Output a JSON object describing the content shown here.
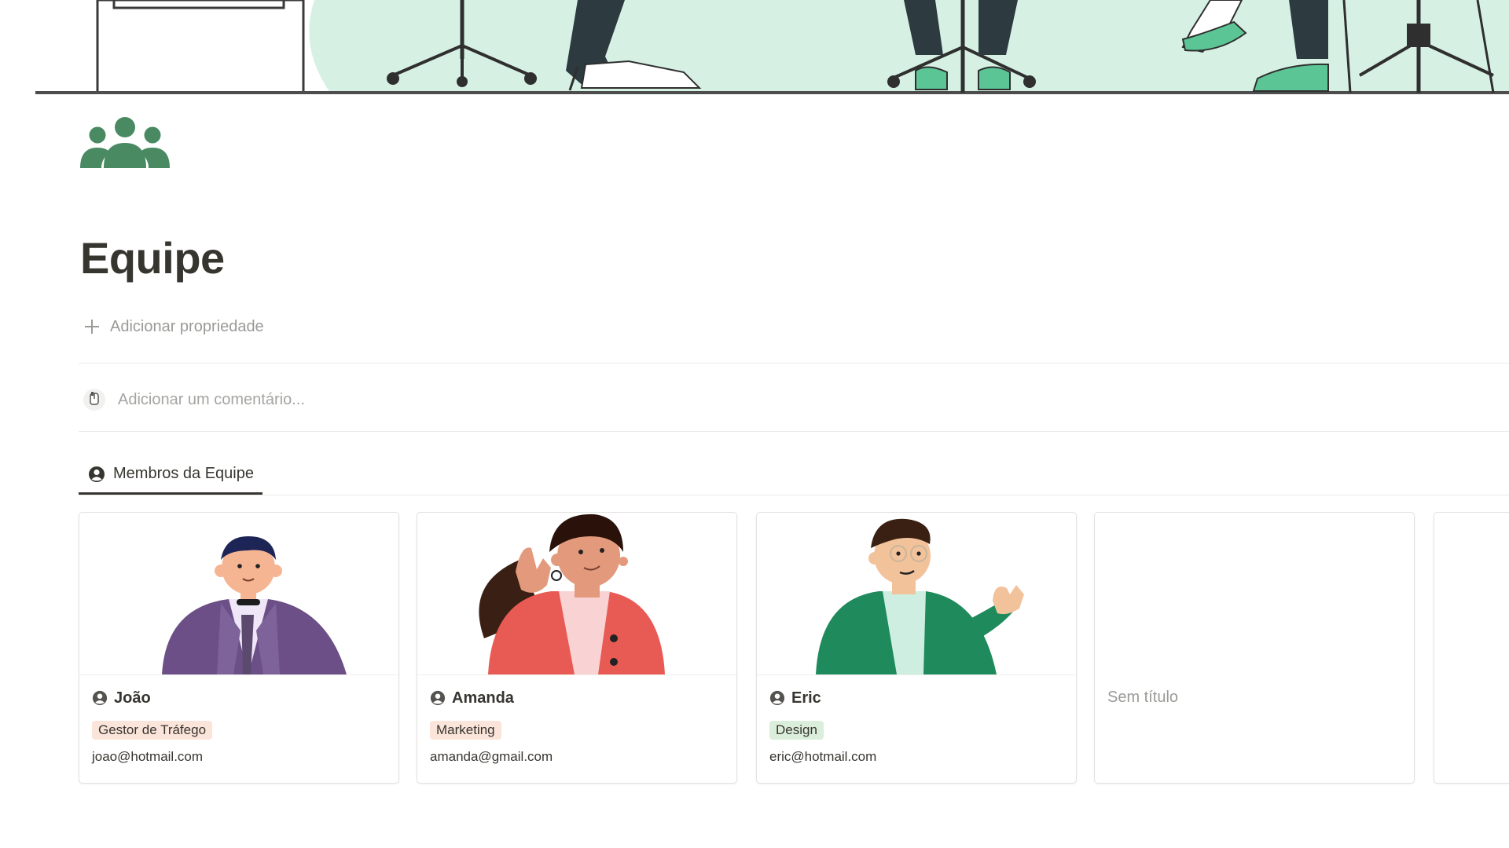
{
  "page": {
    "title": "Equipe",
    "page_icon": "group-icon",
    "cover": "office-illustration"
  },
  "properties": {
    "add_label": "Adicionar propriedade"
  },
  "comments": {
    "placeholder": "Adicionar um comentário..."
  },
  "view_tab": {
    "label": "Membros da Equipe",
    "icon": "person-icon"
  },
  "cards": [
    {
      "name": "João",
      "tag": "Gestor de Tráfego",
      "tag_color": "#fbe4da",
      "email": "joao@hotmail.com",
      "image": "joao-avatar"
    },
    {
      "name": "Amanda",
      "tag": "Marketing",
      "tag_color": "#fbe4da",
      "email": "amanda@gmail.com",
      "image": "amanda-avatar"
    },
    {
      "name": "Eric",
      "tag": "Design",
      "tag_color": "#dbeddb",
      "email": "eric@hotmail.com",
      "image": "eric-avatar"
    },
    {
      "name": "Sem título",
      "image": ""
    }
  ],
  "colors": {
    "accent_green": "#4a8a62",
    "text": "#37352f",
    "muted": "#9b9a97"
  }
}
